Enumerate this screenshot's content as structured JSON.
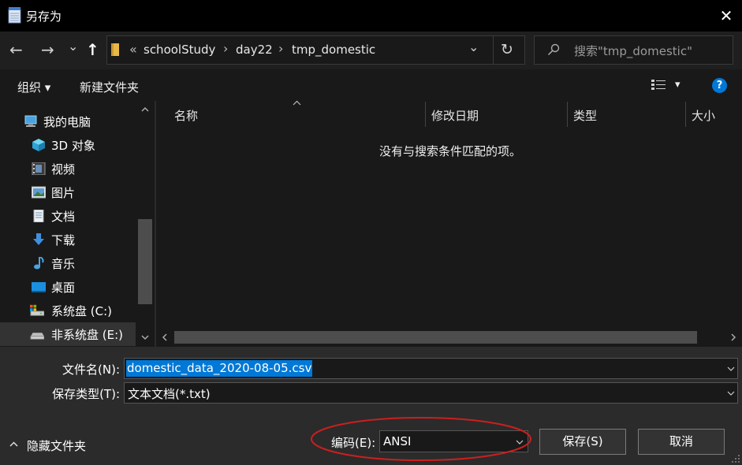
{
  "window": {
    "title": "另存为",
    "close_icon": "✕"
  },
  "address": {
    "back_icon": "←",
    "forward_icon": "→",
    "recent_icon": "⌄",
    "up_icon": "↑",
    "overflow": "«",
    "crumbs": [
      "schoolStudy",
      "day22",
      "tmp_domestic"
    ],
    "crumb_sep": "›",
    "dropdown_icon": "⌄",
    "refresh_icon": "↻"
  },
  "search": {
    "placeholder": "搜索\"tmp_domestic\""
  },
  "toolbar": {
    "organize": "组织 ▾",
    "new_folder": "新建文件夹",
    "view_caret": "▾",
    "help": "?"
  },
  "nav": {
    "items": [
      {
        "label": "我的电脑",
        "icon": "computer-icon"
      },
      {
        "label": "3D 对象",
        "icon": "3d-objects-icon"
      },
      {
        "label": "视频",
        "icon": "video-icon"
      },
      {
        "label": "图片",
        "icon": "pictures-icon"
      },
      {
        "label": "文档",
        "icon": "documents-icon"
      },
      {
        "label": "下载",
        "icon": "download-icon"
      },
      {
        "label": "音乐",
        "icon": "music-icon"
      },
      {
        "label": "桌面",
        "icon": "desktop-icon"
      },
      {
        "label": "系统盘 (C:)",
        "icon": "system-drive-icon"
      },
      {
        "label": "非系统盘 (E:)",
        "icon": "drive-icon"
      }
    ],
    "expand_icon": "›"
  },
  "files": {
    "columns": [
      "名称",
      "修改日期",
      "类型",
      "大小"
    ],
    "empty_message": "没有与搜索条件匹配的项。"
  },
  "form": {
    "filename_label": "文件名(N):",
    "filename_value": "domestic_data_2020-08-05.csv",
    "type_label": "保存类型(T):",
    "type_value": "文本文档(*.txt)",
    "encoding_label": "编码(E):",
    "encoding_value": "ANSI",
    "hide_folders": "隐藏文件夹",
    "save": "保存(S)",
    "cancel": "取消"
  },
  "colors": {
    "accent": "#0078d7",
    "annotation": "#cc1f1f",
    "titlebar": "#000000"
  }
}
